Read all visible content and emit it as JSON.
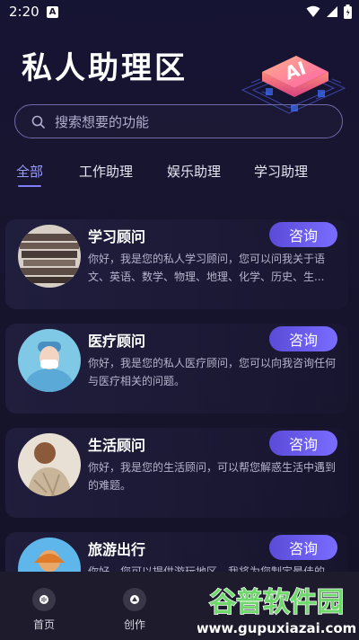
{
  "status": {
    "time": "2:20",
    "a_badge": "A"
  },
  "hero": {
    "title": "私人助理区",
    "art_label": "AI"
  },
  "search": {
    "placeholder": "搜索想要的功能"
  },
  "tabs": [
    {
      "label": "全部",
      "active": true
    },
    {
      "label": "工作助理"
    },
    {
      "label": "娱乐助理"
    },
    {
      "label": "学习助理"
    }
  ],
  "cards": [
    {
      "title": "学习顾问",
      "button": "咨询",
      "desc": "你好，我是您的私人学习顾问，您可以问我关于语文、英语、数学、物理、地理、化学、历史、生..."
    },
    {
      "title": "医疗顾问",
      "button": "咨询",
      "desc": "你好，我是您的私人医疗顾问，您可以向我咨询任何与医疗相关的问题。"
    },
    {
      "title": "生活顾问",
      "button": "咨询",
      "desc": "你好，我是您的生活顾问，可以帮您解惑生活中遇到的难题。"
    },
    {
      "title": "旅游出行",
      "button": "咨询",
      "desc": "你好，您可以提供游玩地区，我将为您制定最佳的..."
    }
  ],
  "nav": [
    {
      "label": "首页",
      "icon": "home-icon"
    },
    {
      "label": "创作",
      "icon": "create-icon"
    }
  ],
  "watermark": {
    "cn": "谷普软件园",
    "url": "www.gupuxiazai.com"
  }
}
